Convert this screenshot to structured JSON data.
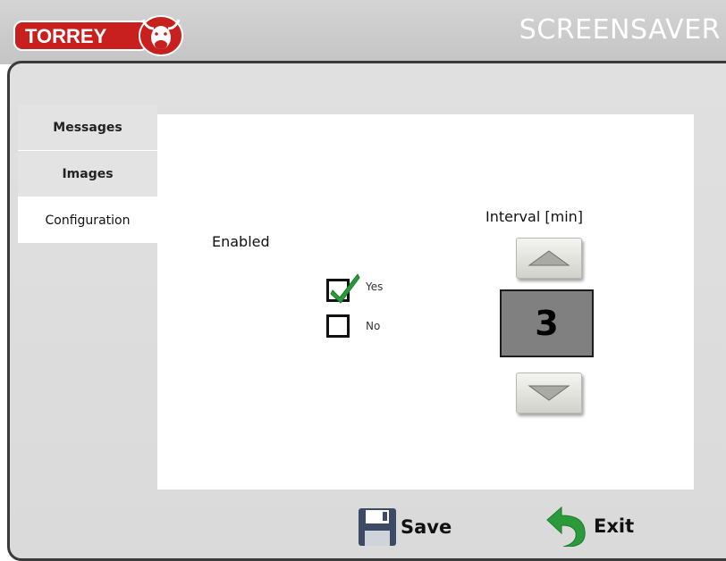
{
  "header": {
    "brand": "TORREY",
    "screen_title": "SCREENSAVER"
  },
  "tabs": [
    {
      "label": "Messages",
      "active": false
    },
    {
      "label": "Images",
      "active": false
    },
    {
      "label": "Configuration",
      "active": true
    }
  ],
  "enabled": {
    "label": "Enabled",
    "options": [
      {
        "label": "Yes",
        "checked": true
      },
      {
        "label": "No",
        "checked": false
      }
    ]
  },
  "interval": {
    "label": "Interval [min]",
    "value": "3"
  },
  "actions": {
    "save_label": "Save",
    "exit_label": "Exit"
  },
  "colors": {
    "brand_red": "#c8201e",
    "check_green": "#2a9a3a",
    "value_bg": "#808080",
    "header_bg": "#c8c8c8"
  }
}
